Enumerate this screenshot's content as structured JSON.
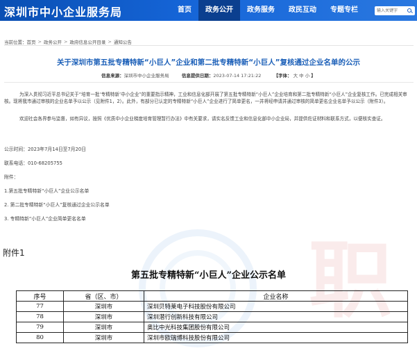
{
  "header": {
    "site_title": "深圳市中小企业服务局",
    "nav": [
      {
        "label": "首页",
        "active": false
      },
      {
        "label": "政务公开",
        "active": true
      },
      {
        "label": "政务服务",
        "active": false
      },
      {
        "label": "政民互动",
        "active": false
      },
      {
        "label": "专题专栏",
        "active": false
      }
    ],
    "search": {
      "placeholder": "输入关键字"
    }
  },
  "breadcrumb": {
    "prefix": "当前位置：",
    "items": [
      "首页",
      "政务公开",
      "政府信息公开目录",
      "通知公告"
    ]
  },
  "article": {
    "title": "关于深圳市第五批专精特新“小巨人”企业和第二批专精特新“小巨人”复核通过企业名单的公示",
    "meta": {
      "source_label": "信息来源：",
      "source": "深圳市中小企业服务局",
      "date_label": "信息提供日期：",
      "date": "2023-07-14 17:21:22",
      "font_label": "【字体：",
      "font_large": "大",
      "font_medium": "中",
      "font_small": "小",
      "font_close": "】"
    },
    "para1": "为深入贯彻习近平总书记关于“培育一批‘专精特新’中小企业”的重要指示精神，工业和信息化部开展了第五批专精特新“小巨人”企业培育和第二批专精特新“小巨人”企业复核工作。已完成相关审核。现将我市通过审核的企业名单予以公示（见附件1，2）。此外，有部分已认定的专精特新“小巨人”企业进行了简单更名，一并将经申请并通过审核的简单更名企业名单予以公示（附件3）。",
    "para2": "欢迎社会各界参与监督，如有异议，按照《优质中小企业梯度培育管理暂行办法》中有关要求，请实名反馈工业和信息化部中小企业局，并提供佐证材料和联系方式，以便核实查证。",
    "period_label": "公示时间：",
    "period": "2023年7月14日至7月20日",
    "phone_label": "联系电话：",
    "phone": "010-68205755",
    "attachments_label": "附件：",
    "attachments": [
      "1.第五批专精特新“小巨人”企业公示名单",
      "2. 第二批专精特新“小巨人”复核通过企业公示名单",
      "3. 专精特新“小巨人”企业简单更名名单"
    ]
  },
  "attachment_preview": {
    "heading": "附件1",
    "title": "第五批专精特新“小巨人”企业公示名单",
    "table": {
      "headers": [
        "序号",
        "省（区、市）",
        "企业名称"
      ],
      "rows": [
        [
          "77",
          "深圳市",
          "深圳贝特莱电子科技股份有限公司"
        ],
        [
          "78",
          "深圳市",
          "深圳潜行创新科技有限公司"
        ],
        [
          "79",
          "深圳市",
          "奥比中光科技集团股份有限公司"
        ],
        [
          "80",
          "深圳市",
          "深圳市欧瑞博科技股份有限公司"
        ]
      ]
    }
  }
}
